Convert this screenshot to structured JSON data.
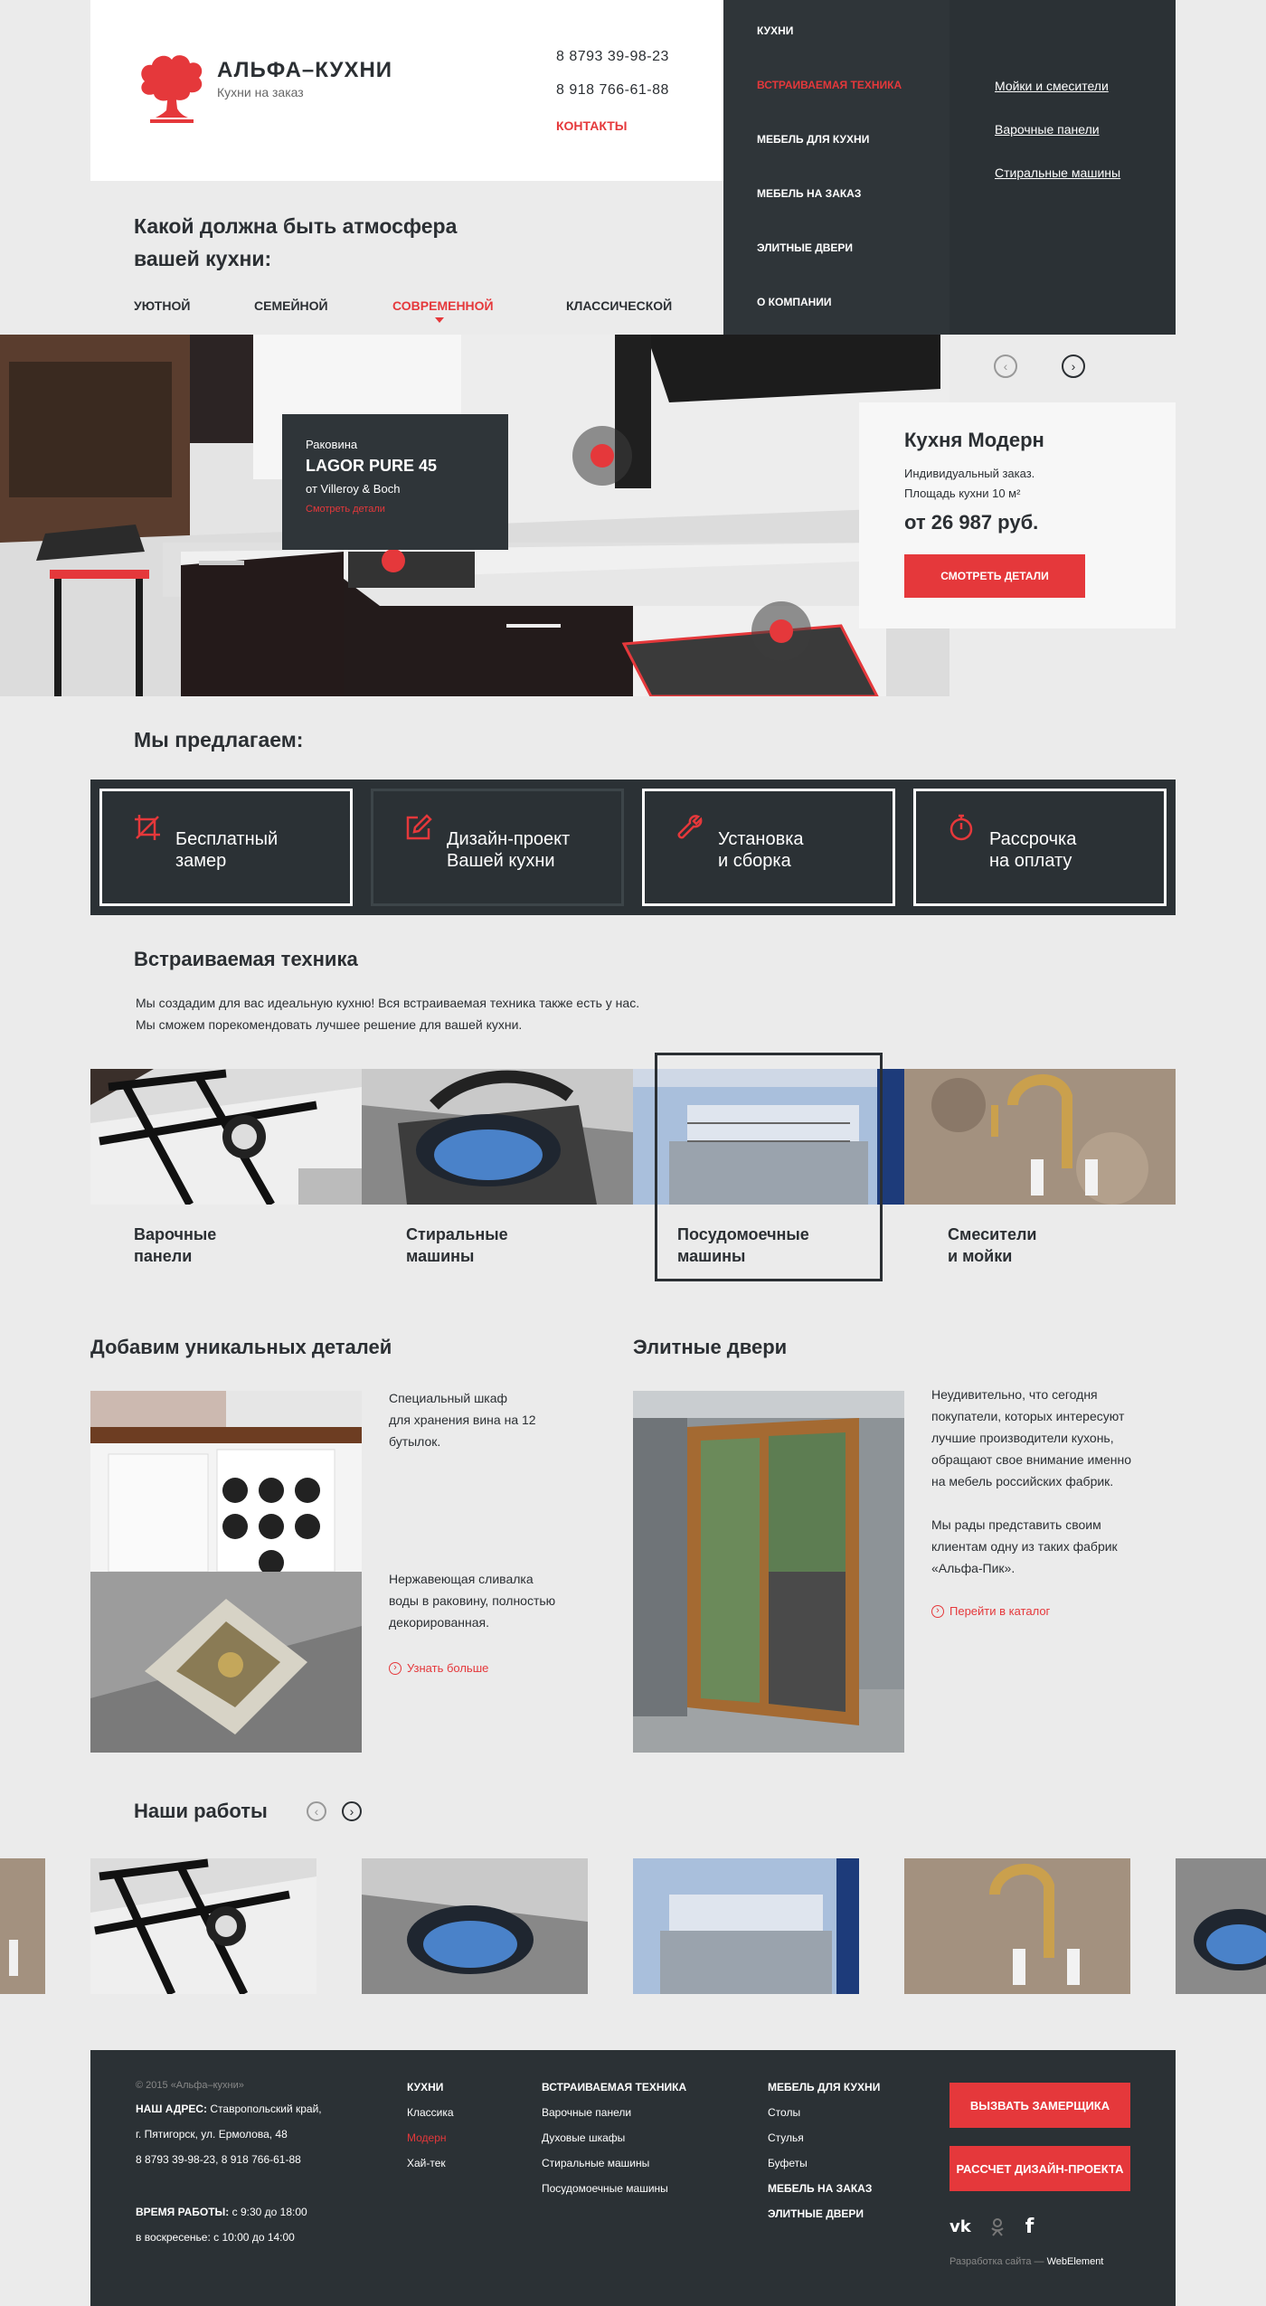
{
  "header": {
    "logo_name": "АЛЬФА–КУХНИ",
    "logo_sub": "Кухни на заказ",
    "phone1": "8 8793 39-98-23",
    "phone2": "8 918 766-61-88",
    "contacts": "КОНТАКТЫ"
  },
  "menu": {
    "items": [
      {
        "label": "КУХНИ",
        "active": false
      },
      {
        "label": "ВСТРАИВАЕМАЯ ТЕХНИКА",
        "active": true
      },
      {
        "label": "МЕБЕЛЬ ДЛЯ КУХНИ",
        "active": false
      },
      {
        "label": "МЕБЕЛЬ НА ЗАКАЗ",
        "active": false
      },
      {
        "label": "ЭЛИТНЫЕ ДВЕРИ",
        "active": false
      },
      {
        "label": "О КОМПАНИИ",
        "active": false
      }
    ],
    "submenu": [
      "Мойки и смесители",
      "Варочные панели",
      "Стиральные машины"
    ]
  },
  "atmosphere": {
    "title_line1": "Какой должна быть атмосфера",
    "title_line2": "вашей кухни:",
    "tabs": [
      "УЮТНОЙ",
      "СЕМЕЙНОЙ",
      "СОВРЕМЕННОЙ",
      "КЛАССИЧЕСКОЙ"
    ],
    "active_tab": 2
  },
  "hero": {
    "tooltip": {
      "label": "Раковина",
      "title": "LAGOR PURE 45",
      "brand": "от Villeroy & Boch",
      "link": "Смотреть детали"
    },
    "card": {
      "title": "Кухня Модерн",
      "line1": "Индивидуальный заказ.",
      "line2": "Площадь кухни 10 м²",
      "price": "от 26 987 руб.",
      "button": "СМОТРЕТЬ ДЕТАЛИ"
    }
  },
  "offers": {
    "title": "Мы предлагаем:",
    "items": [
      {
        "line1": "Бесплатный",
        "line2": "замер",
        "icon": "crop-icon"
      },
      {
        "line1": "Дизайн-проект",
        "line2": "Вашей кухни",
        "icon": "edit-icon"
      },
      {
        "line1": "Установка",
        "line2": "и сборка",
        "icon": "wrench-icon"
      },
      {
        "line1": "Рассрочка",
        "line2": "на оплату",
        "icon": "stopwatch-icon"
      }
    ]
  },
  "appliances": {
    "title": "Встраиваемая техника",
    "desc1": "Мы создадим для вас идеальную кухню! Вся встраиваемая техника также есть у нас.",
    "desc2": "Мы сможем порекомендовать лучшее решение для вашей кухни.",
    "items": [
      {
        "line1": "Варочные",
        "line2": "панели"
      },
      {
        "line1": "Стиральные",
        "line2": "машины"
      },
      {
        "line1": "Посудомоечные",
        "line2": "машины"
      },
      {
        "line1": "Смесители",
        "line2": "и мойки"
      }
    ]
  },
  "details": {
    "title": "Добавим уникальных деталей",
    "text1": [
      "Специальный шкаф",
      "для хранения вина на 12",
      "бутылок."
    ],
    "text2": [
      "Нержавеющая сливалка",
      "воды в раковину, полностью",
      "декорированная."
    ],
    "link": "Узнать больше"
  },
  "doors": {
    "title": "Элитные двери",
    "para1": [
      "Неудивительно, что сегодня",
      "покупатели, которых интересуют",
      "лучшие производители кухонь,",
      "обращают свое внимание именно",
      "на мебель российских фабрик."
    ],
    "para2": [
      "Мы рады представить своим",
      "клиентам одну из таких фабрик",
      "«Альфа-Пик»."
    ],
    "link": "Перейти в каталог"
  },
  "works": {
    "title": "Наши работы"
  },
  "footer": {
    "copyright": "© 2015 «Альфа–кухни»",
    "address_label": "НАШ АДРЕС:",
    "address1": "Ставропольский край,",
    "address2": "г. Пятигорск, ул. Ермолова, 48",
    "phones": "8 8793 39-98-23, 8 918 766-61-88",
    "hours_label": "ВРЕМЯ РАБОТЫ:",
    "hours1": "с 9:30 до 18:00",
    "hours2": "в воскресенье: с 10:00 до 14:00",
    "col1": {
      "title": "КУХНИ",
      "items": [
        "Классика",
        "Модерн",
        "Хай-тек"
      ],
      "active": 1
    },
    "col2": {
      "title": "ВСТРАИВАЕМАЯ ТЕХНИКА",
      "items": [
        "Варочные панели",
        "Духовые шкафы",
        "Стиральные машины",
        "Посудомоечные машины"
      ]
    },
    "col3": {
      "title": "МЕБЕЛЬ ДЛЯ КУХНИ",
      "items": [
        "Столы",
        "Стулья",
        "Буфеты"
      ],
      "extra": [
        "МЕБЕЛЬ НА ЗАКАЗ",
        "ЭЛИТНЫЕ ДВЕРИ"
      ]
    },
    "btn1": "ВЫЗВАТЬ ЗАМЕРЩИКА",
    "btn2": "РАССЧЕТ ДИЗАЙН-ПРОЕКТА",
    "dev_prefix": "Разработка сайта — ",
    "dev_name": "WebElement"
  },
  "colors": {
    "accent": "#e5383b",
    "dark": "#2b3135",
    "bg": "#ebebeb"
  }
}
